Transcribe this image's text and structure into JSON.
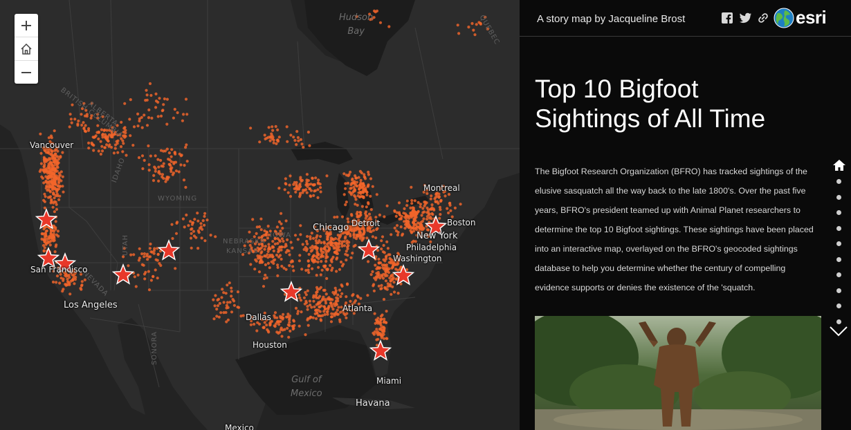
{
  "map": {
    "zoom_in_icon": "plus-icon",
    "home_icon": "home-icon",
    "zoom_out_icon": "minus-icon",
    "water_labels": {
      "hudson": "Hudson\nBay",
      "gulf": "Gulf of\nMexico"
    },
    "region_labels": {
      "bc": "BRITISH COLUMBIA",
      "alberta": "ALBERTA",
      "wyoming": "WYOMING",
      "nebraska": "NEBRASKA",
      "kansas": "KANSAS",
      "iowa": "IOWA",
      "idaho": "IDAHO",
      "utah": "UTAH",
      "nevada": "NEVADA",
      "sonora": "SONORA",
      "quebec": "QUEBEC"
    },
    "city_labels": {
      "vancouver": "Vancouver",
      "montreal": "Montreal",
      "chicago": "Chicago",
      "detroit": "Detroit",
      "boston": "Boston",
      "newyork": "New York",
      "philadelphia": "Philadelphia",
      "washington": "Washington",
      "sanfrancisco": "San Francisco",
      "losangeles": "Los Angeles",
      "dallas": "Dallas",
      "atlanta": "Atlanta",
      "houston": "Houston",
      "miami": "Miami",
      "havana": "Havana",
      "mexico": "Mexico"
    },
    "sightings_color": "#f2652b",
    "star_color": "#e8382a",
    "top10_markers": [
      {
        "rank": "marker-1"
      },
      {
        "rank": "marker-2"
      },
      {
        "rank": "marker-3"
      },
      {
        "rank": "marker-4"
      },
      {
        "rank": "marker-5"
      },
      {
        "rank": "marker-6"
      },
      {
        "rank": "marker-7"
      },
      {
        "rank": "marker-8"
      },
      {
        "rank": "marker-9"
      },
      {
        "rank": "marker-10"
      }
    ]
  },
  "panel": {
    "byline": "A story map by Jacqueline Brost",
    "share_icons": [
      "facebook-icon",
      "twitter-icon",
      "link-icon"
    ],
    "brand_logo": "esri",
    "title_line1": "Top 10 Bigfoot",
    "title_line2": "Sightings of All Time",
    "body_lines": [
      "The Bigfoot Research Organization (BFRO) has tracked sightings of the",
      "elusive sasquatch all the way back to the late 1800's. Over the past five",
      "years, BFRO's president teamed up with Animal Planet researchers to",
      "determine the top 10 Bigfoot sightings. These sightings have been placed",
      "into an interactive map, overlayed on the BFRO's geocoded sightings",
      "database to help you determine whether the century of compelling",
      "evidence supports or denies the existence of the 'squatch."
    ],
    "photo_icon": "bigfoot-photo",
    "nav": {
      "home_icon": "home-icon",
      "dot_count": 10,
      "next_icon": "chevron-down-icon"
    }
  }
}
